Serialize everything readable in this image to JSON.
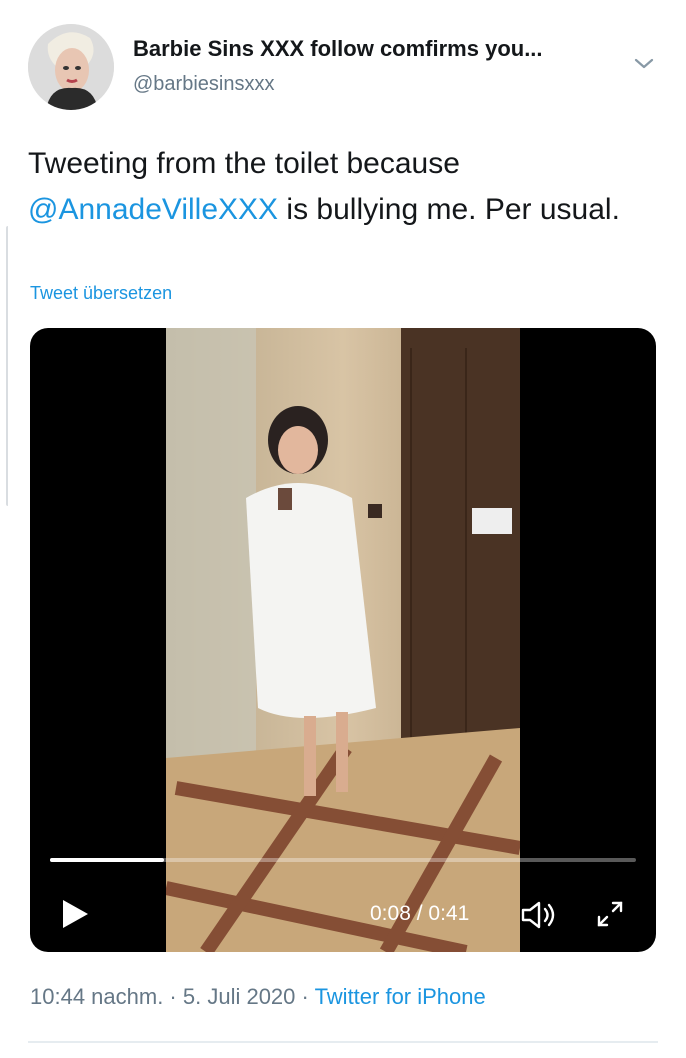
{
  "user": {
    "name": "Barbie Sins XXX follow comfirms you...",
    "handle": "@barbiesinsxxx"
  },
  "tweet": {
    "text_before": "Tweeting from the toilet because",
    "mention": "@AnnadeVilleXXX",
    "text_after": " is bullying me. Per usual.",
    "translate_label": "Tweet übersetzen"
  },
  "video": {
    "current_time": "0:08",
    "separator": " / ",
    "duration": "0:41",
    "progress_fraction": 0.195
  },
  "meta": {
    "time": "10:44 nachm.",
    "dot1": " · ",
    "date": "5. Juli 2020",
    "dot2": " · ",
    "source": "Twitter for iPhone"
  },
  "icons": {
    "menu": "chevron-down-icon",
    "play": "play-icon",
    "volume": "volume-icon",
    "fullscreen": "fullscreen-icon"
  },
  "colors": {
    "link": "#1b95e0",
    "secondary": "#657786",
    "text": "#14171a"
  }
}
